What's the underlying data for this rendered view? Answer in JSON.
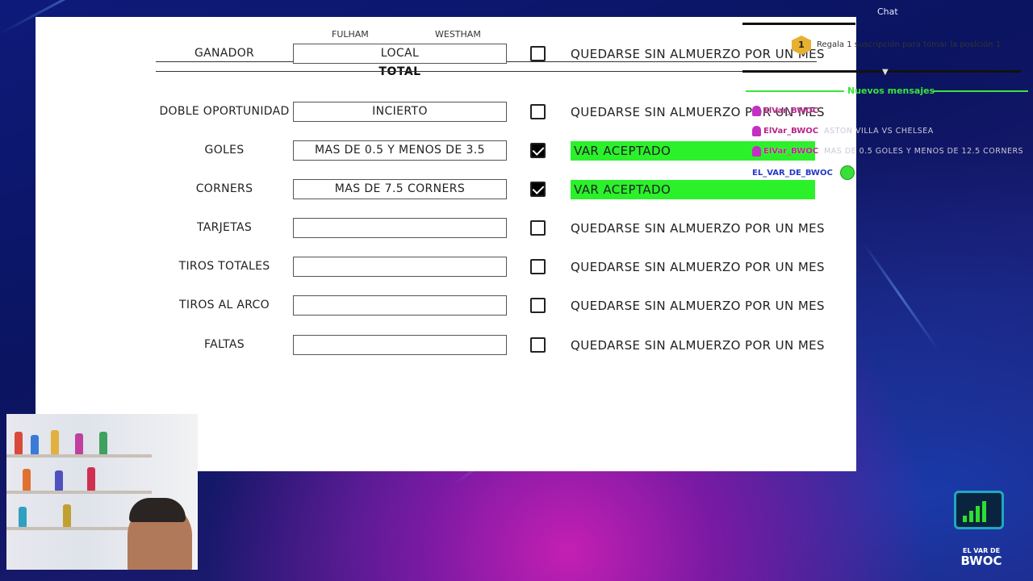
{
  "sheet": {
    "teams": {
      "home": "FULHAM",
      "away": "WESTHAM"
    },
    "total_label": "TOTAL",
    "rows": [
      {
        "label": "GANADOR",
        "value": "LOCAL",
        "checked": false,
        "result": "QUEDARSE SIN ALMUERZO POR UN MES",
        "accepted": false
      },
      {
        "label": "DOBLE OPORTUNIDAD",
        "value": "INCIERTO",
        "checked": false,
        "result": "QUEDARSE SIN ALMUERZO POR UN MES",
        "accepted": false
      },
      {
        "label": "GOLES",
        "value": "MAS DE 0.5 Y MENOS DE 3.5",
        "checked": true,
        "result": "VAR ACEPTADO",
        "accepted": true
      },
      {
        "label": "CORNERS",
        "value": "MAS DE 7.5 CORNERS",
        "checked": true,
        "result": "VAR ACEPTADO",
        "accepted": true
      },
      {
        "label": "TARJETAS",
        "value": "",
        "checked": false,
        "result": "QUEDARSE SIN ALMUERZO POR UN MES",
        "accepted": false
      },
      {
        "label": "TIROS TOTALES",
        "value": "",
        "checked": false,
        "result": "QUEDARSE SIN ALMUERZO POR UN MES",
        "accepted": false
      },
      {
        "label": "TIROS AL ARCO",
        "value": "",
        "checked": false,
        "result": "QUEDARSE SIN ALMUERZO POR UN MES",
        "accepted": false
      },
      {
        "label": "FALTAS",
        "value": "",
        "checked": false,
        "result": "QUEDARSE SIN ALMUERZO POR UN MES",
        "accepted": false
      }
    ],
    "accepted_color": "#2bf12b"
  },
  "chat": {
    "title": "Chat",
    "gift_rank": "1",
    "gift_text": "Regala 1 suscripción para tomar la posición 1",
    "new_messages": "Nuevos mensajes",
    "messages": [
      {
        "user": "ElVar_BWOC",
        "text": ""
      },
      {
        "user": "ElVar_BWOC",
        "text": "ASTON VILLA VS CHELSEA"
      },
      {
        "user": "ElVar_BWOC",
        "text": "MAS DE 0.5 GOLES Y MENOS DE 12.5 CORNERS"
      },
      {
        "user": "EL_VAR_DE_BWOC",
        "text": ""
      }
    ],
    "accent_color": "#39e639"
  },
  "logo": {
    "line1": "EL VAR DE",
    "line2": "BWOC"
  }
}
